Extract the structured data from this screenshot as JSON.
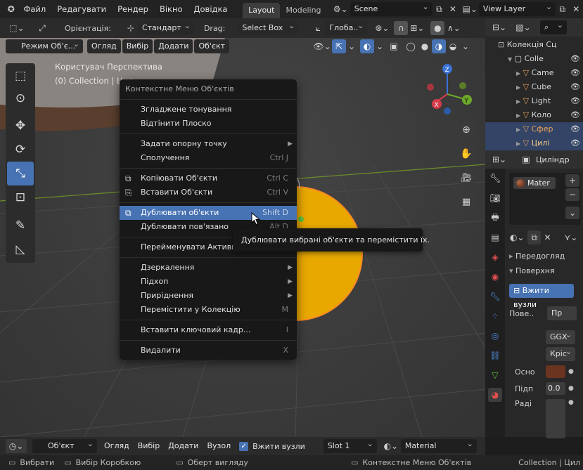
{
  "menubar": {
    "items": [
      "Файл",
      "Редагувати",
      "Рендер",
      "Вікно",
      "Довідка"
    ],
    "tabs": [
      "Layout",
      "Modeling"
    ],
    "scene": "Scene",
    "view_layer": "View Layer"
  },
  "toolheader": {
    "orientation_label": "Орієнтація:",
    "orientation_value": "Стандарт",
    "drag_label": "Drag:",
    "drag_value": "Select Box",
    "transform_orientation": "Глоба.."
  },
  "viewport_header": {
    "mode": "Режим Об'є...",
    "menus": [
      "Огляд",
      "Вибір",
      "Додати",
      "Об'єкт"
    ]
  },
  "viewport": {
    "view_name": "Користувач Перспектива",
    "collection_info": "(0) Collection | Цил",
    "gizmo_axes": [
      "X",
      "Y",
      "Z"
    ]
  },
  "context_menu": {
    "title": "Контекстне Меню Об'єктів",
    "groups": [
      [
        {
          "label": "Згладжене тонування",
          "shortcut": ""
        },
        {
          "label": "Відтінити Плоско",
          "shortcut": ""
        }
      ],
      [
        {
          "label": "Задати опорну точку",
          "shortcut": "",
          "submenu": true
        },
        {
          "label": "Сполучення",
          "shortcut": "Ctrl J"
        }
      ],
      [
        {
          "label": "Копіювати Об'єкти",
          "shortcut": "Ctrl C",
          "icon": "copy-icon"
        },
        {
          "label": "Вставити Об'єкти",
          "shortcut": "Ctrl V",
          "icon": "paste-icon"
        }
      ],
      [
        {
          "label": "Дублювати об'єкти",
          "shortcut": "Shift D",
          "icon": "duplicate-icon",
          "highlighted": true
        },
        {
          "label": "Дублювати пов'язано",
          "shortcut": "Alt D"
        }
      ],
      [
        {
          "label": "Перейменувати Активний Об'єкт",
          "shortcut": ""
        }
      ],
      [
        {
          "label": "Дзеркалення",
          "shortcut": "",
          "submenu": true
        },
        {
          "label": "Підхоп",
          "shortcut": "",
          "submenu": true
        },
        {
          "label": "Приріднення",
          "shortcut": "",
          "submenu": true
        },
        {
          "label": "Перемістити у Колекцію",
          "shortcut": "M"
        }
      ],
      [
        {
          "label": "Вставити ключовий кадр...",
          "shortcut": "I"
        }
      ],
      [
        {
          "label": "Видалити",
          "shortcut": "X"
        }
      ]
    ]
  },
  "tooltip": {
    "text": "Дублювати вибрані об'єкти та перемістити їх."
  },
  "outliner": {
    "title": "Колекція Сц",
    "rows": [
      {
        "label": "Colle",
        "indent": 1,
        "color": "#d6d6d6",
        "selected": false
      },
      {
        "label": "Came",
        "indent": 2,
        "color": "#d6d6d6",
        "selected": false
      },
      {
        "label": "Cube",
        "indent": 2,
        "color": "#d6d6d6",
        "selected": false
      },
      {
        "label": "Light",
        "indent": 2,
        "color": "#d6d6d6",
        "selected": false
      },
      {
        "label": "Коло",
        "indent": 2,
        "color": "#d6d6d6",
        "selected": false
      },
      {
        "label": "Сфер",
        "indent": 2,
        "color": "#f0a65a",
        "selected": true
      },
      {
        "label": "Цилі",
        "indent": 2,
        "color": "#f7c98a",
        "selected": true
      }
    ]
  },
  "properties": {
    "object_name": "Циліндр",
    "material_slot": "Mater",
    "section_preview": "Передогляд",
    "section_surface": "Поверхня",
    "use_nodes_button": "Вжити вузли",
    "surface_label": "Пове..",
    "surface_value": "Пр",
    "distribution": "GGX",
    "subsurface_method": "Кріс",
    "base_color_label": "Осно",
    "base_color": "#6b3420",
    "subsurface_label": "Підп",
    "subsurface_value": "0.0",
    "radius_label": "Раді"
  },
  "footer": {
    "mode": "Об'єкт",
    "menus": [
      "Огляд",
      "Вибір",
      "Додати",
      "Вузол"
    ],
    "use_nodes": "Вжити вузли",
    "slot": "Slot 1",
    "material": "Material"
  },
  "statusbar": {
    "select": "Вибрати",
    "box_select": "Вибір Коробкою",
    "rotate_view": "Оберт вигляду",
    "context_menu": "Контекстне Меню Об'єктів",
    "collection": "Collection | Цил"
  },
  "colors": {
    "accent": "#4772b3",
    "background": "#1d1d1d",
    "viewport": "#3d3d3d",
    "sphere": "#e8a800",
    "selection_outline": "#ff8b1f"
  }
}
